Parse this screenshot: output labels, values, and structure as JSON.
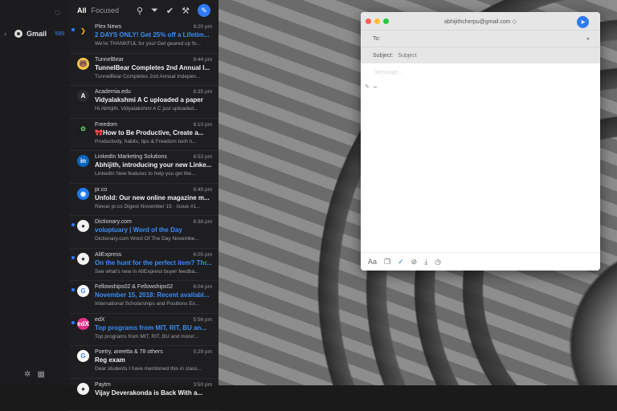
{
  "accounts": {
    "items": [
      {
        "name": "Gmail",
        "count": "589"
      }
    ]
  },
  "list_toolbar": {
    "tab_all": "All",
    "tab_focused": "Focused"
  },
  "messages": [
    {
      "sender": "Plex News",
      "time": "9:20 pm",
      "subject": "2 DAYS ONLY! Get 25% off a Lifetim...",
      "preview": "We're THANKFUL for you! Get geared up fo...",
      "unread": true,
      "avatar_bg": "#1c1c1e",
      "avatar_glyph": "❯",
      "avatar_color": "#e5a00d"
    },
    {
      "sender": "TunnelBear",
      "time": "8:44 pm",
      "subject": "TunnelBear Completes 2nd Annual I...",
      "preview": "TunnelBear Completes 2nd Annual Indepen...",
      "unread": false,
      "avatar_bg": "#f6c445",
      "avatar_glyph": "🐻",
      "avatar_color": "#6b3d12"
    },
    {
      "sender": "Academia.edu",
      "time": "8:35 pm",
      "subject": "Vidyalakshmi A C uploaded a paper",
      "preview": "Hi Abhijith, Vidyalakshmi A C just uploaded...",
      "unread": false,
      "avatar_bg": "#2b2b2d",
      "avatar_glyph": "A",
      "avatar_color": "#ffffff"
    },
    {
      "sender": "Freedom",
      "time": "8:10 pm",
      "subject": "🎀How to Be Productive, Create a...",
      "preview": "Productivity, habits, tips & Freedom tech n...",
      "unread": false,
      "avatar_bg": "#1c1c1e",
      "avatar_glyph": "✿",
      "avatar_color": "#5fbf6b"
    },
    {
      "sender": "LinkedIn Marketing Solutions",
      "time": "6:53 pm",
      "subject": "Abhijith, introducing your new Linke...",
      "preview": "LinkedIn New features to help you get the...",
      "unread": false,
      "avatar_bg": "#0a66c2",
      "avatar_glyph": "in",
      "avatar_color": "#ffffff"
    },
    {
      "sender": "pr.co",
      "time": "6:49 pm",
      "subject": "Unfold: Our new online magazine m...",
      "preview": "Revue pr.co Digest November 15 · Issue #1...",
      "unread": false,
      "avatar_bg": "#1d7cf2",
      "avatar_glyph": "◉",
      "avatar_color": "#ffffff"
    },
    {
      "sender": "Dictionary.com",
      "time": "6:38 pm",
      "subject": "voluptuary | Word of the Day",
      "preview": "Dictionary.com Word Of The Day Novembe...",
      "unread": true,
      "avatar_bg": "#f2f2f2",
      "avatar_glyph": "●",
      "avatar_color": "#333333"
    },
    {
      "sender": "AliExpress",
      "time": "6:05 pm",
      "subject": "On the hunt for the perfect item? Thr...",
      "preview": "See what's new in AliExpress buyer feedba...",
      "unread": true,
      "avatar_bg": "#f2f2f2",
      "avatar_glyph": "●",
      "avatar_color": "#333333"
    },
    {
      "sender": "Fellowships02 & Fellowships02",
      "time": "6:04 pm",
      "subject": "November 15, 2018: Recent availabl...",
      "preview": "International Scholarships and Positions Ex...",
      "unread": true,
      "avatar_bg": "#ffffff",
      "avatar_glyph": "G",
      "avatar_color": "#4285f4"
    },
    {
      "sender": "edX",
      "time": "5:56 pm",
      "subject": "Top programs from MIT, RIT, BU an...",
      "preview": "Top programs from MIT, RIT, BU and more!...",
      "unread": true,
      "avatar_bg": "#e62e8c",
      "avatar_glyph": "edX",
      "avatar_color": "#ffffff"
    },
    {
      "sender": "Poetry, aneetta & 78 others",
      "time": "5:29 pm",
      "subject": "Reg exam",
      "preview": "Dear students I have mentioned this in class...",
      "unread": false,
      "avatar_bg": "#ffffff",
      "avatar_glyph": "G",
      "avatar_color": "#4285f4"
    },
    {
      "sender": "Paytm",
      "time": "3:50 pm",
      "subject": "Vijay Deverakonda is Back With a...",
      "preview": "",
      "unread": false,
      "avatar_bg": "#f2f2f2",
      "avatar_glyph": "●",
      "avatar_color": "#333333"
    }
  ],
  "compose": {
    "from": "abhijithcherpu@gmail.com ◇",
    "to_label": "To:",
    "to_value": "",
    "subject_label": "Subject:",
    "subject_placeholder": "Subject",
    "body_placeholder": "Message...",
    "signature_line": "–"
  }
}
